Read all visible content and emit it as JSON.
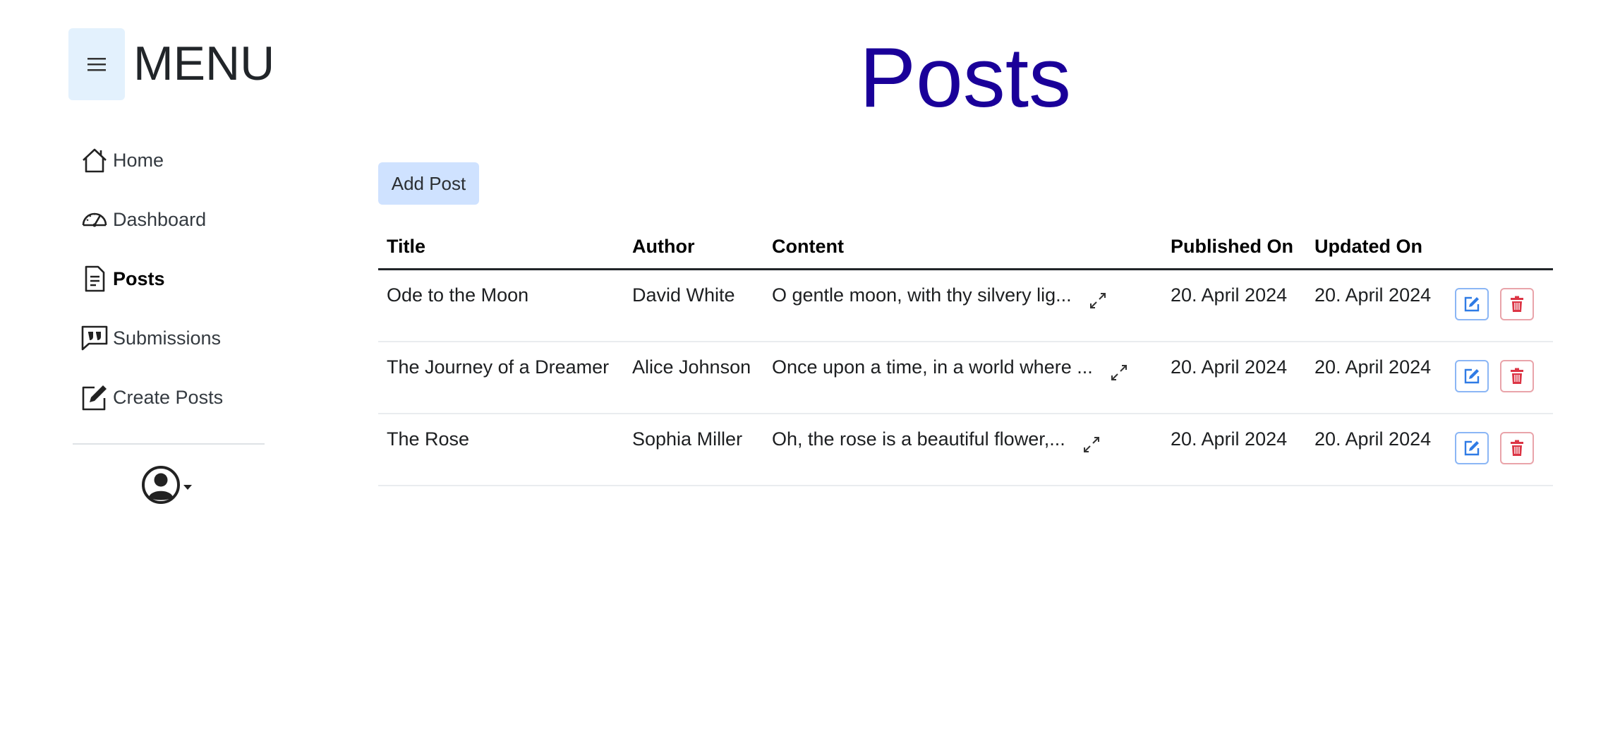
{
  "sidebar": {
    "menu_title": "MENU",
    "items": [
      {
        "label": "Home",
        "icon": "home-icon",
        "active": false
      },
      {
        "label": "Dashboard",
        "icon": "speedometer-icon",
        "active": false
      },
      {
        "label": "Posts",
        "icon": "document-icon",
        "active": true
      },
      {
        "label": "Submissions",
        "icon": "quote-bubble-icon",
        "active": false
      },
      {
        "label": "Create Posts",
        "icon": "pencil-square-icon",
        "active": false
      }
    ],
    "user_icon": "user-circle-icon"
  },
  "main": {
    "title": "Posts",
    "add_button": "Add Post",
    "table": {
      "columns": [
        "Title",
        "Author",
        "Content",
        "Published On",
        "Updated On"
      ],
      "rows": [
        {
          "title": "Ode to the Moon",
          "author": "David White",
          "content": "O gentle moon, with thy silvery lig...",
          "published": "20. April 2024",
          "updated": "20. April 2024"
        },
        {
          "title": "The Journey of a Dreamer",
          "author": "Alice Johnson",
          "content": "Once upon a time, in a world where ...",
          "published": "20. April 2024",
          "updated": "20. April 2024"
        },
        {
          "title": "The Rose",
          "author": "Sophia Miller",
          "content": "Oh, the rose is a beautiful flower,...",
          "published": "20. April 2024",
          "updated": "20. April 2024"
        }
      ]
    }
  },
  "colors": {
    "title": "#1a0099",
    "menu_toggle_bg": "#e3f1fd",
    "add_button_bg": "#cfe2ff",
    "edit_accent": "#2f7be5",
    "delete_accent": "#dc3545"
  }
}
